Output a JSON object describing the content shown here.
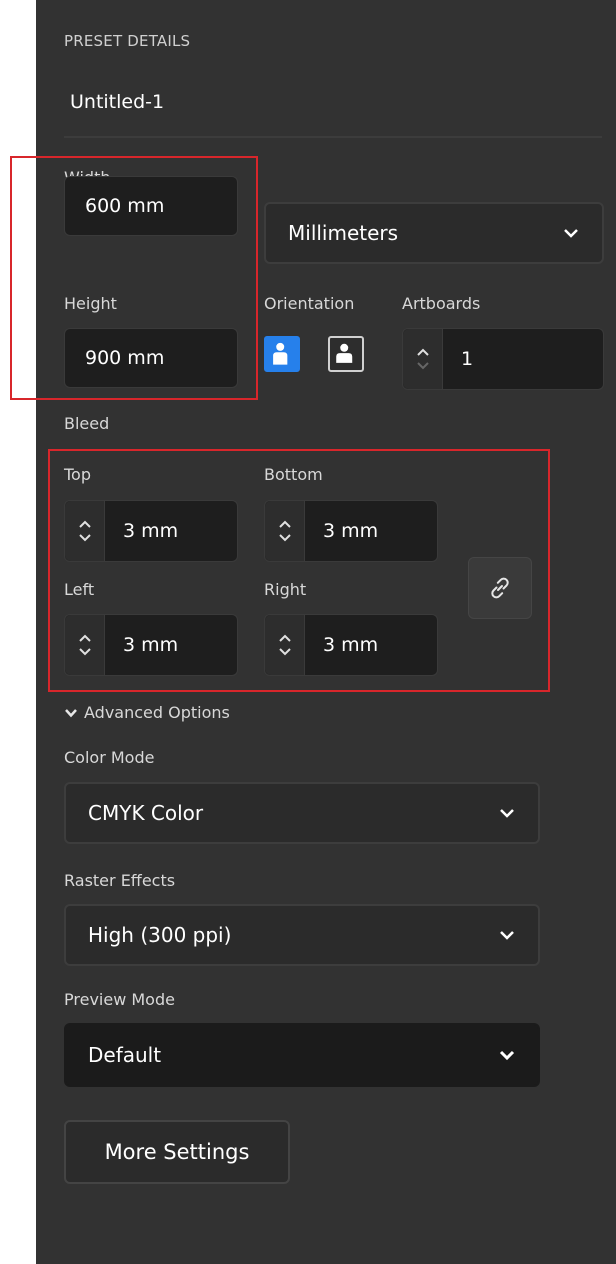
{
  "preset": {
    "section_title": "PRESET DETAILS",
    "document_name": "Untitled-1"
  },
  "size": {
    "width_label": "Width",
    "width_value": "600 mm",
    "units_value": "Millimeters",
    "height_label": "Height",
    "height_value": "900 mm",
    "orientation_label": "Orientation",
    "artboards_label": "Artboards",
    "artboards_value": "1"
  },
  "bleed": {
    "label": "Bleed",
    "top_label": "Top",
    "top_value": "3 mm",
    "bottom_label": "Bottom",
    "bottom_value": "3 mm",
    "left_label": "Left",
    "left_value": "3 mm",
    "right_label": "Right",
    "right_value": "3 mm"
  },
  "advanced": {
    "toggle_label": "Advanced Options",
    "color_mode_label": "Color Mode",
    "color_mode_value": "CMYK Color",
    "raster_label": "Raster Effects",
    "raster_value": "High (300 ppi)",
    "preview_label": "Preview Mode",
    "preview_value": "Default"
  },
  "actions": {
    "more_settings_label": "More Settings"
  },
  "colors": {
    "panel_bg": "#323232",
    "field_bg": "#1e1e1e",
    "accent_blue": "#2680eb",
    "highlight_red": "#d8262b"
  },
  "icons": [
    "chevron-down-icon",
    "portrait-icon",
    "landscape-icon",
    "stepper-up-icon",
    "stepper-down-icon",
    "link-icon"
  ]
}
